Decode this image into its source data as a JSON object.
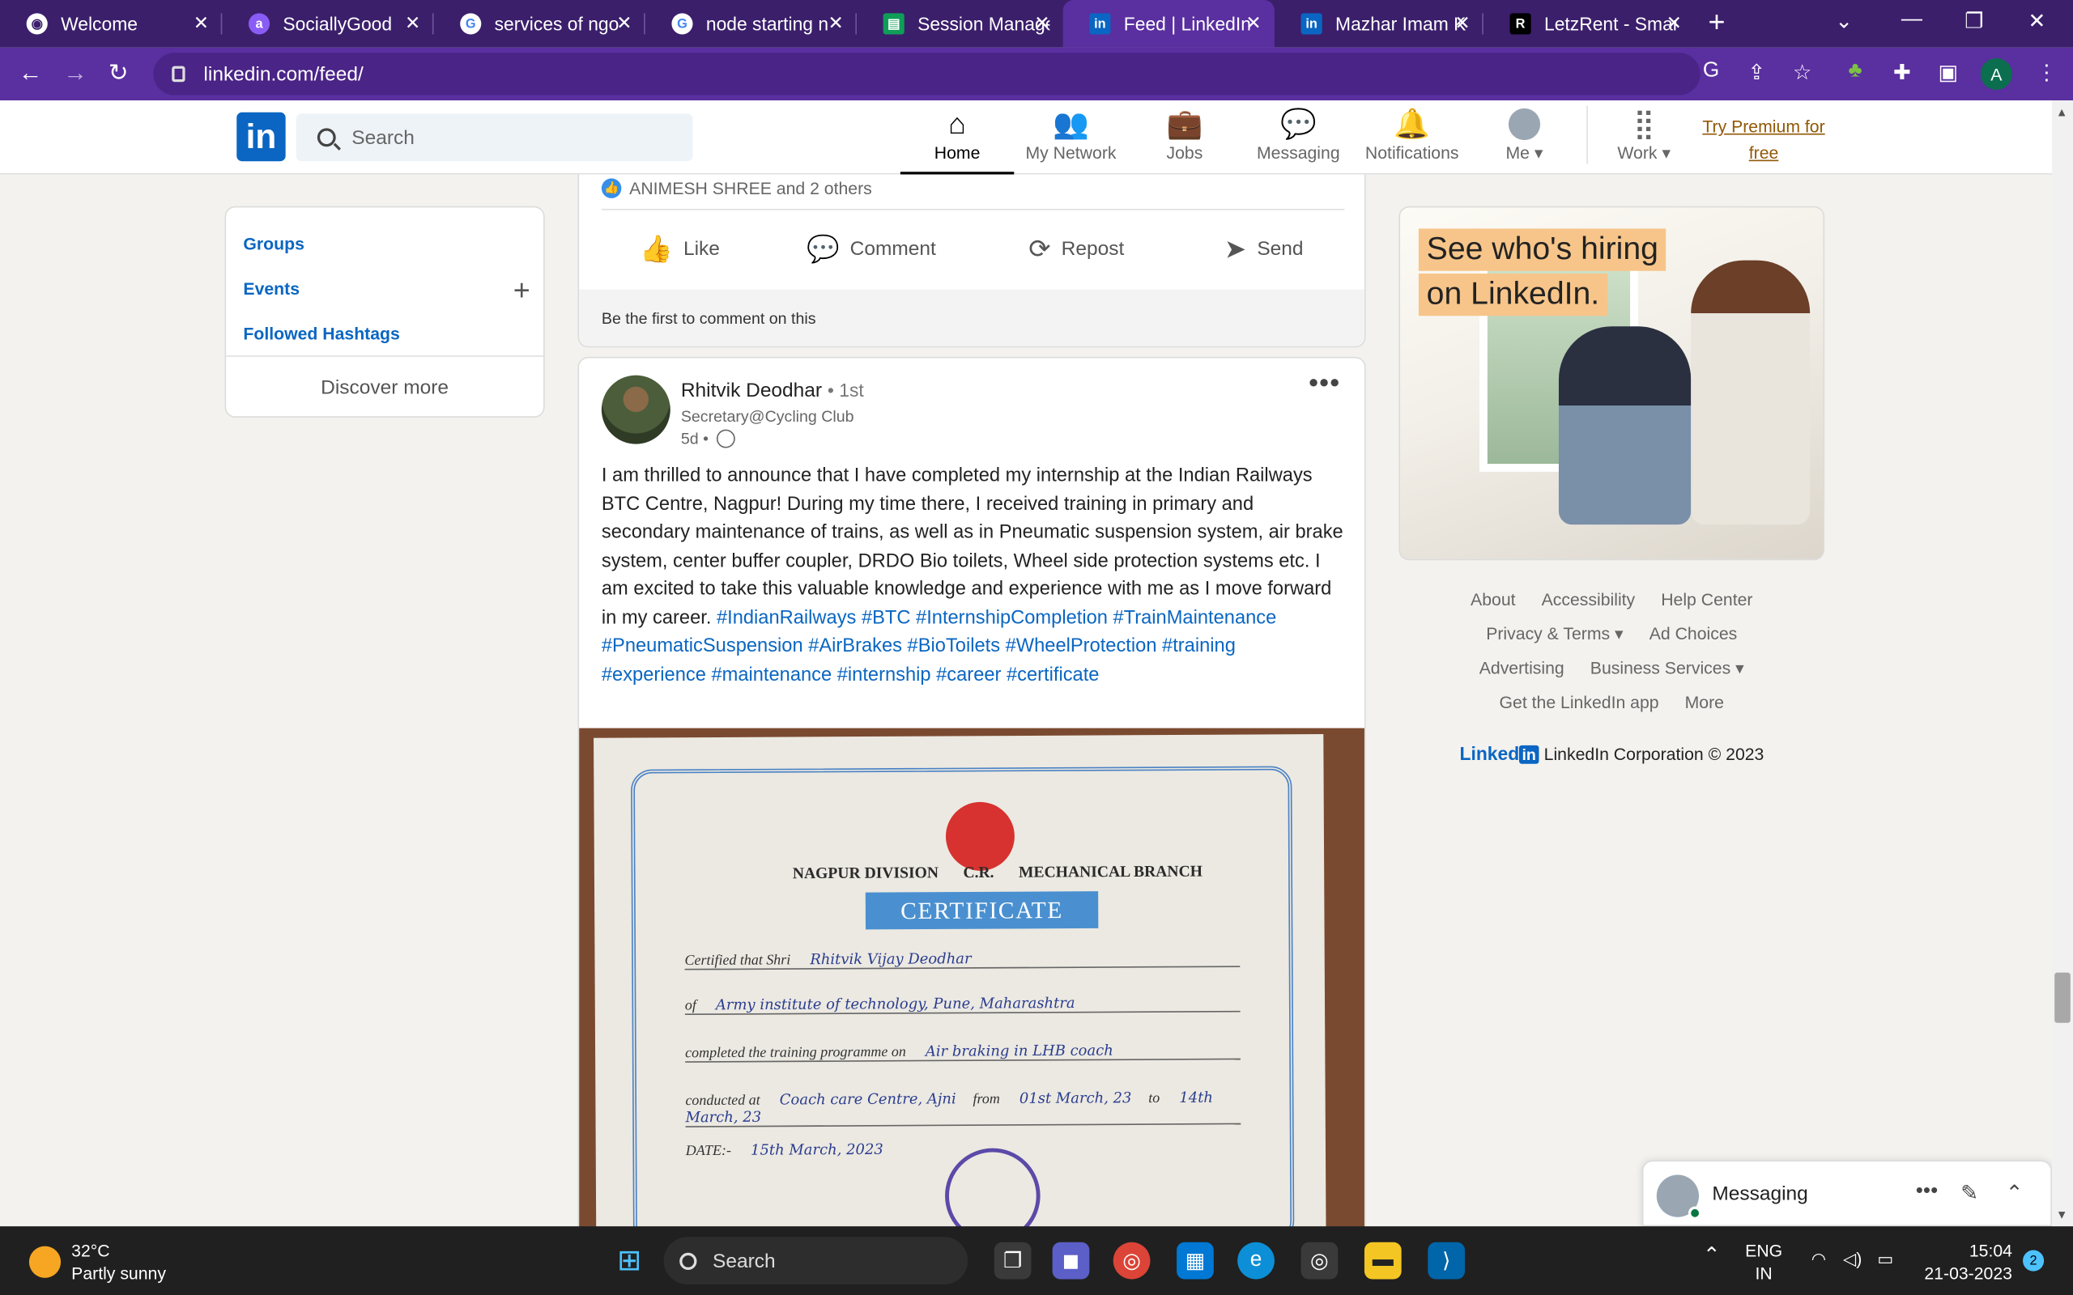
{
  "browser": {
    "tabs": [
      {
        "title": "Welcome",
        "favicon": "globe-icon",
        "color": "#ffffff"
      },
      {
        "title": "SociallyGood",
        "favicon": "socially-good-icon",
        "color": "#8a5cf6"
      },
      {
        "title": "services of ngo",
        "favicon": "google-icon",
        "color": "#ffffff"
      },
      {
        "title": "node starting n",
        "favicon": "google-icon",
        "color": "#ffffff"
      },
      {
        "title": "Session Manage",
        "favicon": "sheets-icon",
        "color": "#0f9d58"
      },
      {
        "title": "Feed | LinkedIn",
        "favicon": "linkedin-icon",
        "color": "#0a66c2",
        "active": true
      },
      {
        "title": "Mazhar Imam K",
        "favicon": "linkedin-icon",
        "color": "#0a66c2"
      },
      {
        "title": "LetzRent - Smar",
        "favicon": "letzrent-icon",
        "color": "#000000"
      }
    ],
    "url": "linkedin.com/feed/",
    "profile_initial": "A"
  },
  "linkedin": {
    "logo": "in",
    "search_placeholder": "Search",
    "nav": [
      {
        "label": "Home",
        "icon": "home-icon",
        "active": true
      },
      {
        "label": "My Network",
        "icon": "network-icon"
      },
      {
        "label": "Jobs",
        "icon": "briefcase-icon"
      },
      {
        "label": "Messaging",
        "icon": "chat-icon"
      },
      {
        "label": "Notifications",
        "icon": "bell-icon"
      },
      {
        "label": "Me",
        "icon": "avatar-icon"
      },
      {
        "label": "Work",
        "icon": "grid-icon"
      }
    ],
    "premium": "Try Premium for free"
  },
  "sidebar": {
    "links": [
      "Groups",
      "Events",
      "Followed Hashtags"
    ],
    "discover": "Discover more"
  },
  "post_a": {
    "reactions": "ANIMESH SHREE and 2 others",
    "actions": [
      "Like",
      "Comment",
      "Repost",
      "Send"
    ],
    "comment_prompt": "Be the first to comment on this"
  },
  "post_b": {
    "author": "Rhitvik Deodhar",
    "degree": "• 1st",
    "headline": "Secretary@Cycling Club",
    "time": "5d •",
    "body": "I am thrilled to announce that I have completed my internship at the Indian Railways BTC Centre, Nagpur! During my time there, I received training in primary and secondary maintenance of trains, as well as in Pneumatic suspension system, air brake system, center buffer coupler, DRDO Bio toilets, Wheel side protection systems etc. I am excited to take this valuable knowledge and experience with me as I move forward in my career. ",
    "hashtags": "#IndianRailways #BTC #InternshipCompletion #TrainMaintenance #PneumaticSuspension #AirBrakes #BioToilets #WheelProtection #training #experience #maintenance #internship #career #certificate",
    "certificate": {
      "division": "NAGPUR DIVISION",
      "cr": "C.R.",
      "branch": "MECHANICAL BRANCH",
      "title": "CERTIFICATE",
      "certified_label": "Certified that Shri",
      "name": "Rhitvik Vijay Deodhar",
      "of_label": "of",
      "institute": "Army institute of technology, Pune, Maharashtra",
      "completed_label": "completed the training programme on",
      "programme": "Air braking in LHB coach",
      "conducted_label": "conducted at",
      "venue": "Coach care Centre, Ajni",
      "from_label": "from",
      "from_date": "01st March, 23",
      "to_label": "to",
      "to_date": "14th March, 23",
      "date_label": "DATE:-",
      "date": "15th March, 2023"
    }
  },
  "ad": {
    "line1": "See who's hiring",
    "line2": "on LinkedIn."
  },
  "footer": {
    "rows": [
      [
        "About",
        "Accessibility",
        "Help Center"
      ],
      [
        "Privacy & Terms ▾",
        "Ad Choices"
      ],
      [
        "Advertising",
        "Business Services ▾"
      ],
      [
        "Get the LinkedIn app",
        "More"
      ]
    ],
    "brand": "Linked",
    "brand_in": "in",
    "copyright": "LinkedIn Corporation © 2023"
  },
  "messaging": {
    "title": "Messaging"
  },
  "taskbar": {
    "temp": "32°C",
    "weather": "Partly sunny",
    "search": "Search",
    "lang1": "ENG",
    "lang2": "IN",
    "time": "15:04",
    "date": "21-03-2023",
    "notifications": "2"
  }
}
